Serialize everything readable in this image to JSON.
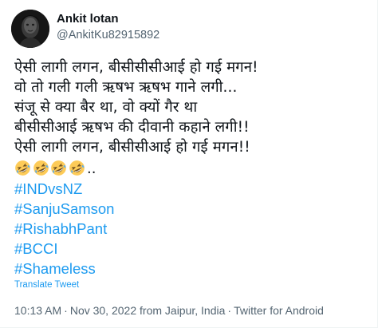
{
  "author": {
    "display_name": "Ankit lotan",
    "handle": "@AnkitKu82915892",
    "avatar_icon": "profile-photo-dark"
  },
  "tweet": {
    "lines": [
      "ऐसी लागी लगन, बीसीसीसीआई हो गई मगन!",
      "वो तो गली गली ऋषभ ऋषभ गाने लगी...",
      "संजू से क्या बैर था, वो क्यों गैर था",
      "बीसीसीआई ऋषभ की दीवानी कहाने लगी!!",
      "ऐसी लागी लगन, बीसीसीआई हो गई मगन!!"
    ],
    "emoji_icon": "rolling-on-floor-laughing-emoji",
    "emoji_count": 4,
    "emoji_suffix": "..",
    "hashtags": [
      "#INDvsNZ",
      "#SanjuSamson",
      "#RishabhPant",
      "#BCCI",
      "#Shameless"
    ],
    "translate_label": "Translate Tweet"
  },
  "meta": {
    "time": "10:13 AM",
    "date": "Nov 30, 2022",
    "location_prefix": "from",
    "location": "Jaipur, India",
    "source": "Twitter for Android",
    "separator": "·"
  },
  "colors": {
    "text": "#0f1419",
    "secondary": "#536471",
    "link": "#1d9bf0",
    "emoji_face": "#fdcb58"
  }
}
